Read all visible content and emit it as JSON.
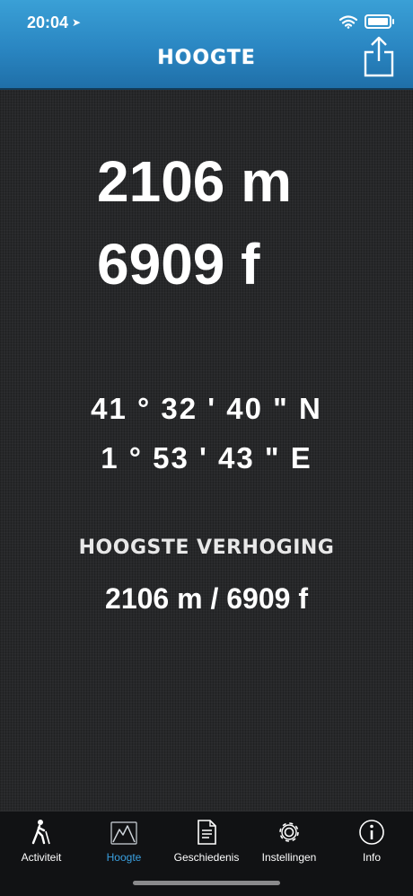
{
  "status_bar": {
    "time": "20:04"
  },
  "header": {
    "title": "HOOGTE"
  },
  "altitude": {
    "meters": "2106 m",
    "feet": "6909 f"
  },
  "coordinates": {
    "latitude": "41 ° 32 ' 40 \" N",
    "longitude": "1 ° 53 ' 43 \" E"
  },
  "max_elevation": {
    "label": "HOOGSTE VERHOGING",
    "value": "2106 m / 6909 f"
  },
  "tabs": [
    {
      "label": "Activiteit",
      "icon": "hiker-icon"
    },
    {
      "label": "Hoogte",
      "icon": "mountain-icon",
      "active": true
    },
    {
      "label": "Geschiedenis",
      "icon": "document-icon"
    },
    {
      "label": "Instellingen",
      "icon": "gear-icon"
    },
    {
      "label": "Info",
      "icon": "info-icon"
    }
  ],
  "colors": {
    "accent": "#3aa0e0",
    "header": "#2a86c2",
    "background": "#27282a"
  }
}
